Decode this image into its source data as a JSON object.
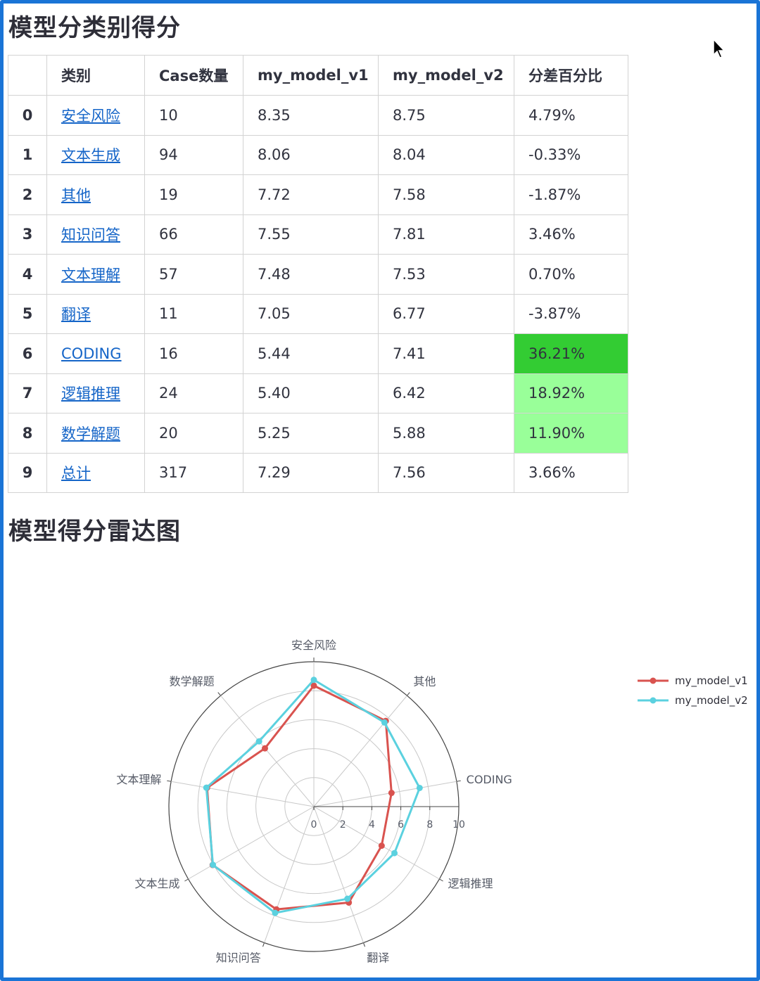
{
  "sections": {
    "table_title": "模型分类别得分",
    "chart_title": "模型得分雷达图"
  },
  "table": {
    "headers": [
      "",
      "类别",
      "Case数量",
      "my_model_v1",
      "my_model_v2",
      "分差百分比"
    ],
    "rows": [
      {
        "index": "0",
        "category": "安全风险",
        "count": "10",
        "v1": "8.35",
        "v2": "8.75",
        "diff": "4.79%",
        "highlight": ""
      },
      {
        "index": "1",
        "category": "文本生成",
        "count": "94",
        "v1": "8.06",
        "v2": "8.04",
        "diff": "-0.33%",
        "highlight": ""
      },
      {
        "index": "2",
        "category": "其他",
        "count": "19",
        "v1": "7.72",
        "v2": "7.58",
        "diff": "-1.87%",
        "highlight": ""
      },
      {
        "index": "3",
        "category": "知识问答",
        "count": "66",
        "v1": "7.55",
        "v2": "7.81",
        "diff": "3.46%",
        "highlight": ""
      },
      {
        "index": "4",
        "category": "文本理解",
        "count": "57",
        "v1": "7.48",
        "v2": "7.53",
        "diff": "0.70%",
        "highlight": ""
      },
      {
        "index": "5",
        "category": "翻译",
        "count": "11",
        "v1": "7.05",
        "v2": "6.77",
        "diff": "-3.87%",
        "highlight": ""
      },
      {
        "index": "6",
        "category": "CODING",
        "count": "16",
        "v1": "5.44",
        "v2": "7.41",
        "diff": "36.21%",
        "highlight": "#33cc33"
      },
      {
        "index": "7",
        "category": "逻辑推理",
        "count": "24",
        "v1": "5.40",
        "v2": "6.42",
        "diff": "18.92%",
        "highlight": "#99ff99"
      },
      {
        "index": "8",
        "category": "数学解题",
        "count": "20",
        "v1": "5.25",
        "v2": "5.88",
        "diff": "11.90%",
        "highlight": "#99ff99"
      },
      {
        "index": "9",
        "category": "总计",
        "count": "317",
        "v1": "7.29",
        "v2": "7.56",
        "diff": "3.66%",
        "highlight": ""
      }
    ]
  },
  "chart_data": {
    "type": "radar",
    "categories": [
      "安全风险",
      "其他",
      "CODING",
      "逻辑推理",
      "翻译",
      "知识问答",
      "文本生成",
      "文本理解",
      "数学解题"
    ],
    "radial_ticks": [
      "0",
      "2",
      "4",
      "6",
      "8",
      "10"
    ],
    "range": [
      0,
      10
    ],
    "series": [
      {
        "name": "my_model_v1",
        "color": "#d9534f",
        "values": [
          8.35,
          7.72,
          5.44,
          5.4,
          7.05,
          7.55,
          8.06,
          7.48,
          5.25
        ]
      },
      {
        "name": "my_model_v2",
        "color": "#5bd1df",
        "values": [
          8.75,
          7.58,
          7.41,
          6.42,
          6.77,
          7.81,
          8.04,
          7.53,
          5.88
        ]
      }
    ],
    "legend_position": "right",
    "grid": true
  },
  "colors": {
    "frame": "#1a74d6",
    "link": "#1565c8",
    "strong_highlight": "#33cc33",
    "light_highlight": "#99ff99"
  }
}
